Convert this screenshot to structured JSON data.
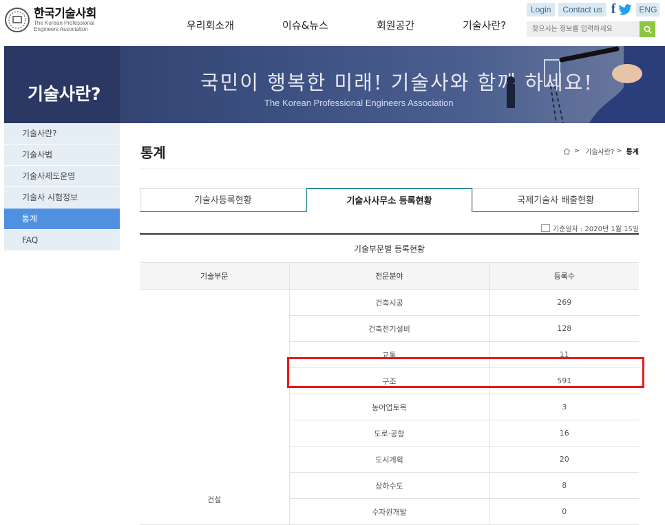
{
  "header": {
    "logo_kr": "한국기술사회",
    "logo_en_line1": "The Korean Professional",
    "logo_en_line2": "Engineers Association",
    "nav": [
      "우리회소개",
      "이슈&뉴스",
      "회원공간",
      "기술사란?"
    ],
    "util": {
      "login": "Login",
      "contact": "Contact us",
      "facebook": "f",
      "eng": "ENG"
    },
    "search_placeholder": "찾으시는 정보를 입력하세요"
  },
  "banner": {
    "title": "기술사란?",
    "slogan": "국민이 행복한 미래! 기술사와 함께 하세요!",
    "subtitle": "The Korean Professional Engineers Association"
  },
  "sidebar": {
    "items": [
      {
        "label": "기술사란?",
        "active": false
      },
      {
        "label": "기술사법",
        "active": false
      },
      {
        "label": "기술사제도운영",
        "active": false
      },
      {
        "label": "기술사 시험정보",
        "active": false
      },
      {
        "label": "통계",
        "active": true
      },
      {
        "label": "FAQ",
        "active": false
      }
    ]
  },
  "content": {
    "title": "통계",
    "breadcrumb": {
      "sep": ">",
      "parent": "기술사란?",
      "current": "통계"
    },
    "tabs": [
      {
        "label": "기술사등록현황",
        "active": false
      },
      {
        "label": "기술사사무소 등록현황",
        "active": true
      },
      {
        "label": "국제기술사 배출현황",
        "active": false
      }
    ],
    "date_stamp": "기준일자 : 2020년 1월 15일",
    "table": {
      "caption": "기술부문별 등록현황",
      "headers": [
        "기술부문",
        "전문분야",
        "등록수"
      ],
      "group": "건설",
      "rows": [
        {
          "field": "건축시공",
          "count": "269"
        },
        {
          "field": "건축전기설비",
          "count": "128"
        },
        {
          "field": "교통",
          "count": "11"
        },
        {
          "field": "구조",
          "count": "591"
        },
        {
          "field": "농어업토목",
          "count": "3"
        },
        {
          "field": "도로·공항",
          "count": "16"
        },
        {
          "field": "도시계획",
          "count": "20"
        },
        {
          "field": "상하수도",
          "count": "8"
        },
        {
          "field": "수자원개발",
          "count": "0"
        }
      ]
    }
  },
  "colors": {
    "accent": "#4f91e0",
    "highlight": "#e51b1b",
    "search_button": "#8dc63f"
  }
}
